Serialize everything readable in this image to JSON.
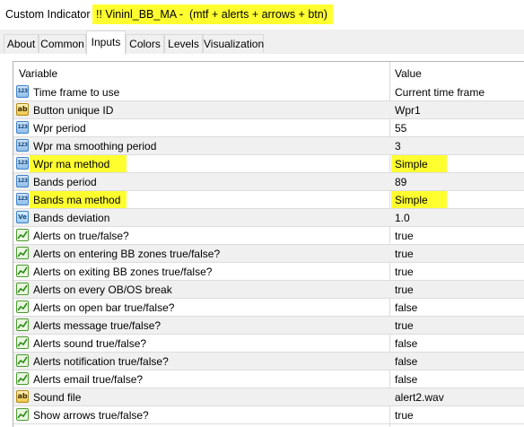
{
  "window": {
    "title_static": "Custom Indicator - ",
    "title_highlight": "!! Vininl_BB_MA -  (mtf + alerts + arrows + btn)"
  },
  "tabs": [
    {
      "label": "About"
    },
    {
      "label": "Common"
    },
    {
      "label": "Inputs"
    },
    {
      "label": "Colors"
    },
    {
      "label": "Levels"
    },
    {
      "label": "Visualization"
    }
  ],
  "table": {
    "headers": {
      "variable": "Variable",
      "value": "Value"
    },
    "rows": [
      {
        "icon": "number-icon",
        "variable": "Time frame to use",
        "value": "Current time frame"
      },
      {
        "icon": "string-icon",
        "variable": "Button unique ID",
        "value": "Wpr1"
      },
      {
        "icon": "number-icon",
        "variable": "Wpr period",
        "value": "55"
      },
      {
        "icon": "number-icon",
        "variable": "Wpr ma smoothing period",
        "value": "3"
      },
      {
        "icon": "number-icon",
        "variable": "Wpr ma method",
        "value": "Simple",
        "highlight": true
      },
      {
        "icon": "number-icon",
        "variable": "Bands period",
        "value": "89"
      },
      {
        "icon": "number-icon",
        "variable": "Bands ma method",
        "value": "Simple",
        "highlight": true
      },
      {
        "icon": "double-icon",
        "variable": "Bands deviation",
        "value": "1.0"
      },
      {
        "icon": "bool-icon",
        "variable": "Alerts on true/false?",
        "value": "true"
      },
      {
        "icon": "bool-icon",
        "variable": "Alerts on entering BB zones true/false?",
        "value": "true"
      },
      {
        "icon": "bool-icon",
        "variable": "Alerts on exiting BB zones true/false?",
        "value": "true"
      },
      {
        "icon": "bool-icon",
        "variable": "Alerts on every OB/OS break",
        "value": "true"
      },
      {
        "icon": "bool-icon",
        "variable": "Alerts on open bar true/false?",
        "value": "false"
      },
      {
        "icon": "bool-icon",
        "variable": "Alerts message true/false?",
        "value": "true"
      },
      {
        "icon": "bool-icon",
        "variable": "Alerts sound true/false?",
        "value": "false"
      },
      {
        "icon": "bool-icon",
        "variable": "Alerts notification true/false?",
        "value": "false"
      },
      {
        "icon": "bool-icon",
        "variable": "Alerts email true/false?",
        "value": "false"
      },
      {
        "icon": "string-icon",
        "variable": "Sound file",
        "value": "alert2.wav"
      },
      {
        "icon": "bool-icon",
        "variable": "Show arrows true/false?",
        "value": "true"
      }
    ]
  },
  "icon_glyphs": {
    "number-icon": "123",
    "string-icon": "ab",
    "double-icon": "Ve"
  },
  "colors": {
    "highlight": "#ffff30",
    "selected_tab": "#ffffff",
    "alt_row": "#f0f0f0"
  }
}
